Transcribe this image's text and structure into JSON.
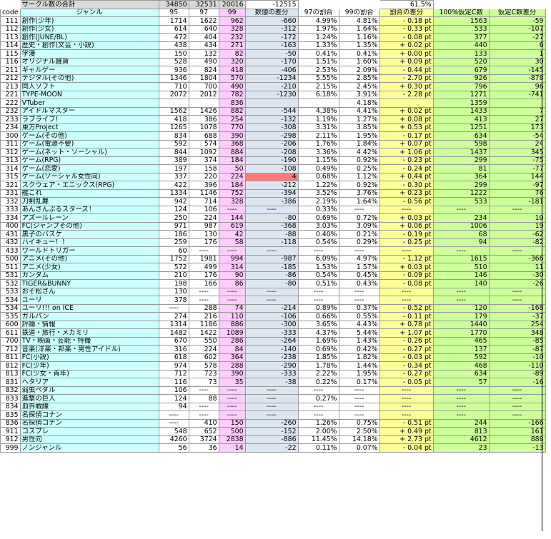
{
  "summary": {
    "label": "サークル数の合計",
    "v95": "34850",
    "v97": "32531",
    "v99": "20016",
    "diff": "-12515",
    "ratio": "61.5%"
  },
  "headers": [
    "code",
    "ジャンル",
    "95",
    "97",
    "99",
    "数値の差分",
    "97の割合",
    "99の割合",
    "割合の差分",
    "100%仮定C数",
    "仮定C数差分"
  ],
  "rows": [
    [
      "111",
      "創作(少年)",
      "1714",
      "1622",
      "962",
      "-660",
      "4.99%",
      "4.81%",
      "- 0.18 pt",
      "1563",
      "-59"
    ],
    [
      "112",
      "創作(少女)",
      "614",
      "640",
      "328",
      "-312",
      "1.97%",
      "1.64%",
      "- 0.33 pt",
      "533",
      "-107"
    ],
    [
      "113",
      "創作(JUNE/BL)",
      "472",
      "404",
      "232",
      "-172",
      "1.24%",
      "1.16%",
      "- 0.08 pt",
      "377",
      "-27"
    ],
    [
      "114",
      "歴史・創作(文芸・小説)",
      "438",
      "434",
      "271",
      "-163",
      "1.33%",
      "1.35%",
      "+ 0.02 pt",
      "440",
      "6"
    ],
    [
      "115",
      "学漫",
      "150",
      "132",
      "82",
      "-50",
      "0.41%",
      "0.41%",
      "+ 0.00 pt",
      "133",
      "1"
    ],
    [
      "116",
      "オリジナル雑貨",
      "528",
      "490",
      "320",
      "-170",
      "1.51%",
      "1.60%",
      "+ 0.09 pt",
      "520",
      "30"
    ],
    [
      "211",
      "ギャルゲー",
      "936",
      "824",
      "418",
      "-406",
      "2.53%",
      "2.09%",
      "- 0.44 pt",
      "679",
      "-145"
    ],
    [
      "212",
      "デジタル(その他)",
      "1346",
      "1804",
      "570",
      "-1234",
      "5.55%",
      "2.85%",
      "- 2.70 pt",
      "926",
      "-878"
    ],
    [
      "213",
      "同人ソフト",
      "710",
      "700",
      "490",
      "-210",
      "2.15%",
      "2.45%",
      "+ 0.30 pt",
      "796",
      "96"
    ],
    [
      "221",
      "TYPE-MOON",
      "2072",
      "2012",
      "782",
      "-1230",
      "6.18%",
      "3.91%",
      "- 2.28 pt",
      "1271",
      "-741"
    ],
    [
      "222",
      "VTuber",
      "",
      "",
      "836",
      "",
      "",
      "4.18%",
      "",
      "1359",
      ""
    ],
    [
      "232",
      "アイドルマスター",
      "1562",
      "1426",
      "882",
      "-544",
      "4.38%",
      "4.41%",
      "+ 0.02 pt",
      "1433",
      "7"
    ],
    [
      "233",
      "ラブライブ!",
      "418",
      "386",
      "254",
      "-132",
      "1.19%",
      "1.27%",
      "+ 0.08 pt",
      "413",
      "27"
    ],
    [
      "234",
      "東方Project",
      "1265",
      "1078",
      "770",
      "-308",
      "3.31%",
      "3.85%",
      "+ 0.53 pt",
      "1251",
      "173"
    ],
    [
      "300",
      "ゲーム(その他)",
      "834",
      "688",
      "390",
      "-298",
      "2.11%",
      "1.95%",
      "- 0.17 pt",
      "634",
      "-54"
    ],
    [
      "311",
      "ゲーム(電源不要)",
      "592",
      "574",
      "368",
      "-206",
      "1.76%",
      "1.84%",
      "+ 0.07 pt",
      "598",
      "24"
    ],
    [
      "312",
      "ゲーム(ネット・ソーシャル)",
      "844",
      "1092",
      "884",
      "-208",
      "3.36%",
      "4.42%",
      "+ 1.06 pt",
      "1437",
      "345"
    ],
    [
      "313",
      "ゲーム(RPG)",
      "389",
      "374",
      "184",
      "-190",
      "1.15%",
      "0.92%",
      "- 0.23 pt",
      "299",
      "-75"
    ],
    [
      "314",
      "ゲーム(恋愛)",
      "197",
      "158",
      "50",
      "-108",
      "0.49%",
      "0.25%",
      "- 0.24 pt",
      "81",
      "-77"
    ],
    [
      "315",
      "ゲーム(ソーシャル女性向)",
      "337",
      "220",
      "224",
      "4",
      "0.68%",
      "1.12%",
      "+ 0.44 pt",
      "364",
      "144"
    ],
    [
      "321",
      "スクウェア・エニックス(RPG)",
      "422",
      "396",
      "184",
      "-212",
      "1.22%",
      "0.92%",
      "- 0.30 pt",
      "299",
      "-97"
    ],
    [
      "331",
      "艦これ",
      "1334",
      "1146",
      "752",
      "-394",
      "3.52%",
      "3.76%",
      "+ 0.23 pt",
      "1222",
      "76"
    ],
    [
      "332",
      "刀剣乱舞",
      "942",
      "714",
      "328",
      "-386",
      "2.19%",
      "1.64%",
      "- 0.56 pt",
      "533",
      "-181"
    ],
    [
      "333",
      "あんさんぶるスターズ！",
      "124",
      "106",
      "----",
      "----",
      "0.33%",
      "----",
      "----",
      "----",
      "----"
    ],
    [
      "334",
      "アズールレーン",
      "250",
      "224",
      "144",
      "-80",
      "0.69%",
      "0.72%",
      "+ 0.03 pt",
      "234",
      "10"
    ],
    [
      "400",
      "FC(ジャンプその他)",
      "971",
      "987",
      "619",
      "-368",
      "3.03%",
      "3.09%",
      "+ 0.06 pt",
      "1006",
      "19"
    ],
    [
      "431",
      "黒子のバスケ",
      "186",
      "130",
      "42",
      "-88",
      "0.40%",
      "0.21%",
      "- 0.19 pt",
      "68",
      "-62"
    ],
    [
      "432",
      "ハイキュー！！",
      "259",
      "176",
      "58",
      "-118",
      "0.54%",
      "0.29%",
      "- 0.25 pt",
      "94",
      "-82"
    ],
    [
      "433",
      "ワールドトリガー",
      "60",
      "----",
      "----",
      "----",
      "----",
      "----",
      "----",
      "----",
      "----"
    ],
    [
      "500",
      "アニメ(その他)",
      "1752",
      "1981",
      "994",
      "-987",
      "6.09%",
      "4.97%",
      "- 1.12 pt",
      "1615",
      "-366"
    ],
    [
      "511",
      "アニメ(少女)",
      "572",
      "499",
      "314",
      "-185",
      "1.53%",
      "1.57%",
      "+ 0.03 pt",
      "510",
      "11"
    ],
    [
      "531",
      "ガンダム",
      "210",
      "176",
      "90",
      "-86",
      "0.54%",
      "0.45%",
      "- 0.09 pt",
      "146",
      "-30"
    ],
    [
      "532",
      "TIGER&BUNNY",
      "198",
      "166",
      "86",
      "-80",
      "0.51%",
      "0.43%",
      "- 0.08 pt",
      "140",
      "-26"
    ],
    [
      "533",
      "おそ松さん",
      "130",
      "----",
      "----",
      "----",
      "----",
      "----",
      "----",
      "----",
      "----"
    ],
    [
      "534",
      "ユーリ",
      "378",
      "----",
      "----",
      "----",
      "----",
      "----",
      "----",
      "----",
      "----"
    ],
    [
      "534",
      "ユーリ!!! on ICE",
      "----",
      "288",
      "74",
      "-214",
      "0.89%",
      "0.37%",
      "- 0.52 pt",
      "120",
      "-168"
    ],
    [
      "535",
      "ガルパン",
      "274",
      "216",
      "110",
      "-106",
      "0.66%",
      "0.55%",
      "- 0.11 pt",
      "179",
      "-37"
    ],
    [
      "600",
      "評論・情報",
      "1314",
      "1186",
      "886",
      "-300",
      "3.65%",
      "4.43%",
      "+ 0.78 pt",
      "1440",
      "254"
    ],
    [
      "611",
      "鉄道・旅行・メカミリ",
      "1482",
      "1422",
      "1089",
      "-333",
      "4.37%",
      "5.44%",
      "+ 1.07 pt",
      "1770",
      "348"
    ],
    [
      "700",
      "TV・映画・芸能・特撮",
      "670",
      "550",
      "286",
      "-264",
      "1.69%",
      "1.43%",
      "- 0.26 pt",
      "465",
      "-85"
    ],
    [
      "712",
      "音楽(洋楽・邦楽・男性アイドル)",
      "316",
      "224",
      "84",
      "-140",
      "0.69%",
      "0.42%",
      "- 0.27 pt",
      "137",
      "-87"
    ],
    [
      "811",
      "FC(小説)",
      "618",
      "602",
      "364",
      "-238",
      "1.85%",
      "1.82%",
      "- 0.03 pt",
      "592",
      "-10"
    ],
    [
      "812",
      "FC(少年)",
      "974",
      "578",
      "288",
      "-290",
      "1.78%",
      "1.44%",
      "- 0.34 pt",
      "468",
      "-110"
    ],
    [
      "813",
      "FC(少女・青年)",
      "712",
      "723",
      "390",
      "-333",
      "2.22%",
      "1.95%",
      "- 0.27 pt",
      "634",
      "-89"
    ],
    [
      "831",
      "ヘタリア",
      "116",
      "73",
      "35",
      "-38",
      "0.22%",
      "0.17%",
      "- 0.05 pt",
      "57",
      "-16"
    ],
    [
      "832",
      "弱虫ペダル",
      "106",
      "----",
      "----",
      "----",
      "----",
      "----",
      "----",
      "----",
      "----"
    ],
    [
      "833",
      "進撃の巨人",
      "124",
      "88",
      "----",
      "----",
      "0.27%",
      "----",
      "----",
      "----",
      "----"
    ],
    [
      "834",
      "血界戦線",
      "94",
      "----",
      "----",
      "----",
      "----",
      "----",
      "----",
      "----",
      "----"
    ],
    [
      "835",
      "名探偵コナン",
      "----",
      "----",
      "----",
      "----",
      "----",
      "----",
      "----",
      "----",
      "----"
    ],
    [
      "836",
      "名探偵コナン",
      "----",
      "410",
      "150",
      "-260",
      "1.26%",
      "0.75%",
      "- 0.51 pt",
      "244",
      "-166"
    ],
    [
      "911",
      "コスプレ",
      "548",
      "652",
      "500",
      "-152",
      "2.00%",
      "2.50%",
      "+ 0.49 pt",
      "813",
      "161"
    ],
    [
      "912",
      "男性向",
      "4260",
      "3724",
      "2838",
      "-886",
      "11.45%",
      "14.18%",
      "+ 2.73 pt",
      "4612",
      "888"
    ],
    [
      "999",
      "ノンジャンル",
      "56",
      "36",
      "14",
      "-22",
      "0.11%",
      "0.07%",
      "- 0.04 pt",
      "23",
      "-13"
    ]
  ],
  "colors": {
    "genre_bg": "#ccffff",
    "col99_bg": "#ffccff",
    "diff_bg": "#dce6f2",
    "ratio_diff_bg": "#ffff99",
    "assumed_bg": "#ccff99",
    "highlight_red": "#ff7b7b"
  }
}
